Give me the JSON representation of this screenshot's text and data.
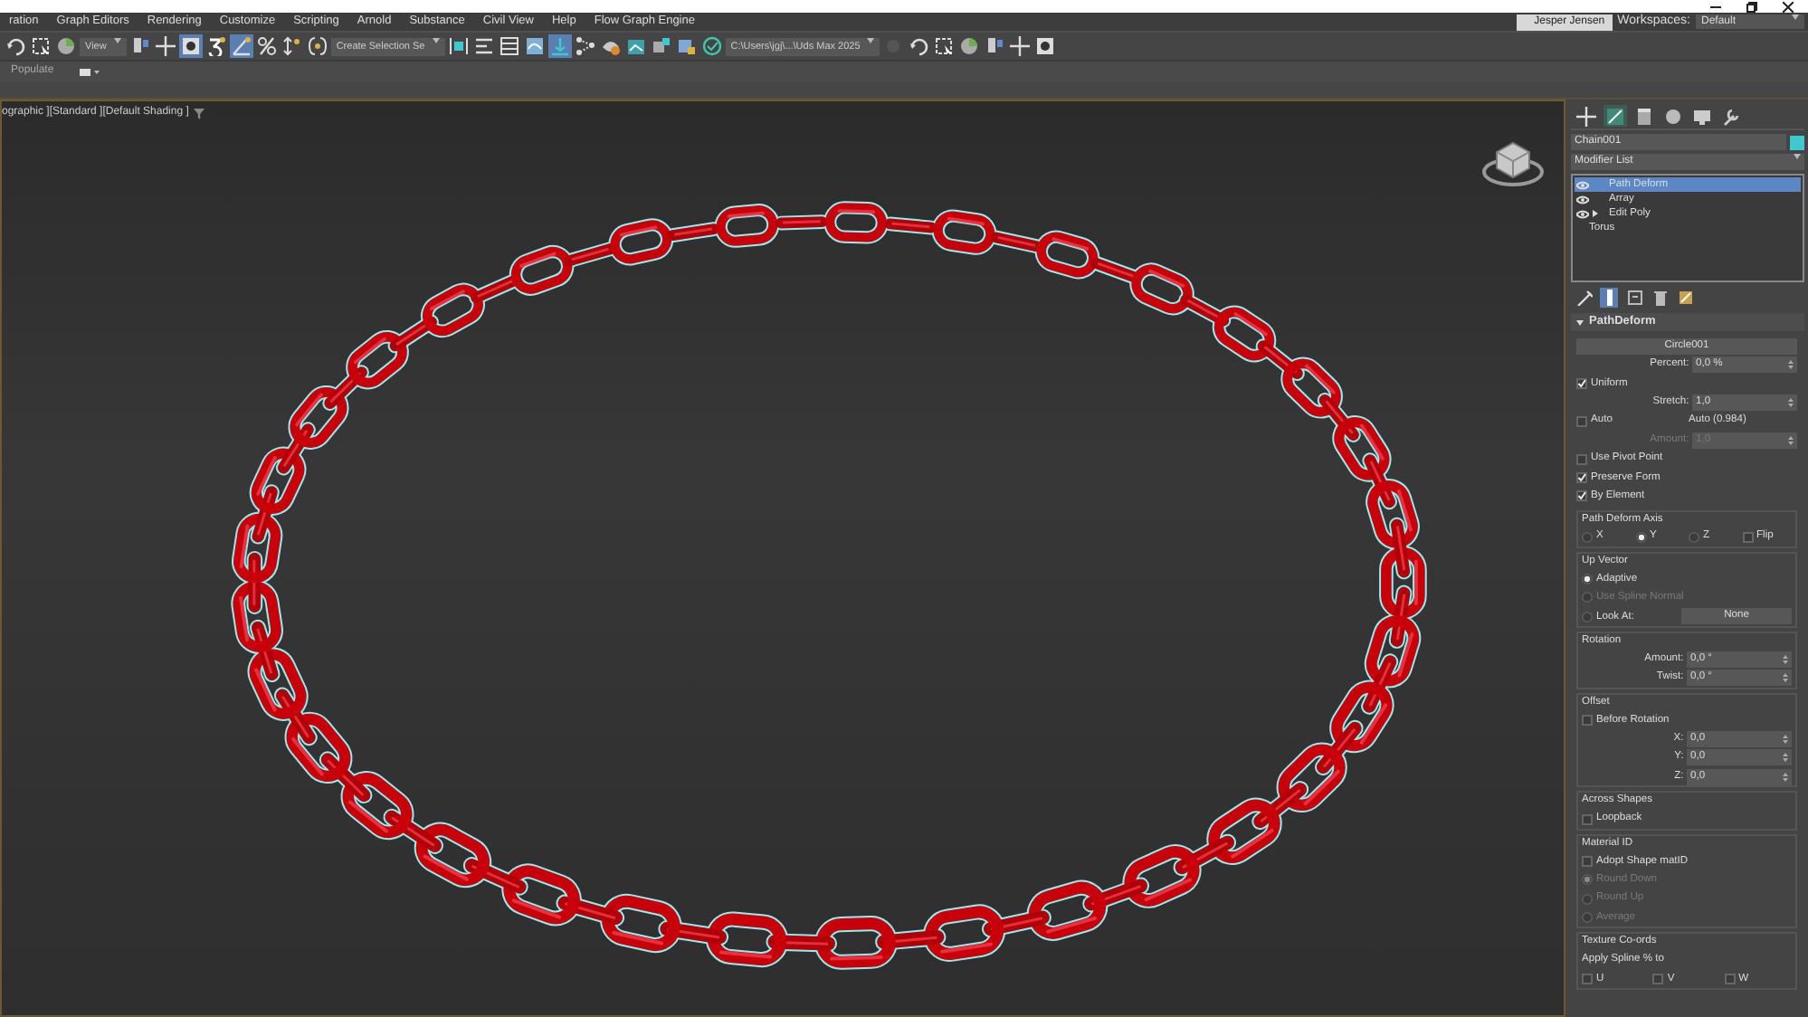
{
  "menu_bar": {
    "items": [
      "ration",
      "Graph Editors",
      "Rendering",
      "Customize",
      "Scripting",
      "Arnold",
      "Substance",
      "Civil View",
      "Help",
      "Flow Graph Engine"
    ]
  },
  "account": {
    "user": "Jesper Jensen",
    "workspaces_label": "Workspaces:",
    "workspace": "Default"
  },
  "toolbar": {
    "items": [
      {
        "kind": "tool",
        "pressed": false
      },
      {
        "kind": "tool",
        "pressed": false
      },
      {
        "kind": "tool",
        "pressed": false
      },
      {
        "kind": "dropdown",
        "value": "View"
      },
      {
        "kind": "tool",
        "pressed": false
      },
      {
        "kind": "tool",
        "pressed": false
      },
      {
        "kind": "tool",
        "pressed": true
      },
      {
        "kind": "tool",
        "pressed": false
      },
      {
        "kind": "tool",
        "pressed": true
      },
      {
        "kind": "tool",
        "pressed": false
      },
      {
        "kind": "tool",
        "pressed": false
      },
      {
        "kind": "tool",
        "pressed": false
      },
      {
        "kind": "dropdown",
        "value": "Create Selection Se"
      },
      {
        "kind": "tool",
        "pressed": false
      },
      {
        "kind": "tool",
        "pressed": false
      },
      {
        "kind": "tool",
        "pressed": false
      },
      {
        "kind": "tool",
        "pressed": false
      },
      {
        "kind": "tool",
        "pressed": true
      },
      {
        "kind": "tool",
        "pressed": false
      },
      {
        "kind": "tool",
        "pressed": false
      },
      {
        "kind": "tool",
        "pressed": false
      },
      {
        "kind": "tool",
        "pressed": false
      },
      {
        "kind": "tool",
        "pressed": false
      },
      {
        "kind": "tool",
        "pressed": false
      },
      {
        "kind": "dropdown",
        "value": "C:\\Users\\jgj\\...\\Uds Max 2025"
      },
      {
        "kind": "tool",
        "pressed": false
      },
      {
        "kind": "tool",
        "pressed": false
      },
      {
        "kind": "tool",
        "pressed": false
      },
      {
        "kind": "tool",
        "pressed": false
      },
      {
        "kind": "tool",
        "pressed": false
      },
      {
        "kind": "tool",
        "pressed": false
      },
      {
        "kind": "tool",
        "pressed": false
      }
    ]
  },
  "ribbon": {
    "tabs": [
      {
        "label": "Populate"
      }
    ]
  },
  "viewport": {
    "label": "ographic ][Standard ][Default Shading ]"
  },
  "command_panel": {
    "tabs": [
      {
        "selected": false
      },
      {
        "selected": true
      },
      {
        "selected": false
      },
      {
        "selected": false
      },
      {
        "selected": false
      },
      {
        "selected": false
      }
    ],
    "object": {
      "name": "Chain001",
      "color": "#3ec8d2"
    },
    "modifier_list": "Modifier List",
    "stack": [
      {
        "kind": "modifier",
        "label": "Path Deform",
        "visible": true,
        "expandable": false,
        "selected": true
      },
      {
        "kind": "modifier",
        "label": "Array",
        "visible": true,
        "expandable": false,
        "selected": false
      },
      {
        "kind": "modifier",
        "label": "Edit Poly",
        "visible": true,
        "expandable": true,
        "selected": false
      },
      {
        "kind": "base",
        "label": "Torus",
        "selected": false
      }
    ],
    "stack_tools": [
      {
        "pressed": false
      },
      {
        "pressed": true
      },
      {
        "pressed": false
      },
      {
        "pressed": false
      },
      {
        "pressed": false
      }
    ],
    "rollout": {
      "title": "PathDeform",
      "sections": [
        {
          "rows": [
            [
              {
                "kind": "button",
                "label": "Circle001"
              }
            ],
            [
              {
                "kind": "spinner",
                "label": "Percent:",
                "value": "0,0 %",
                "disabled": false
              }
            ],
            [
              {
                "kind": "checkbox",
                "label": "Uniform",
                "checked": true,
                "disabled": false
              }
            ],
            [
              {
                "kind": "spinner",
                "label": "Stretch:",
                "value": "1,0",
                "disabled": false
              }
            ],
            [
              {
                "kind": "checkbox",
                "label": "Auto",
                "checked": false,
                "disabled": false
              },
              {
                "kind": "text",
                "label": "Auto (0.984)",
                "disabled": false
              }
            ],
            [
              {
                "kind": "spinner",
                "label": "Amount:",
                "value": "1,0",
                "disabled": true
              }
            ],
            [
              {
                "kind": "checkbox",
                "label": "Use Pivot Point",
                "checked": false,
                "disabled": false
              }
            ],
            [
              {
                "kind": "checkbox",
                "label": "Preserve Form",
                "checked": true,
                "disabled": false
              }
            ],
            [
              {
                "kind": "checkbox",
                "label": "By Element",
                "checked": true,
                "disabled": false
              }
            ]
          ]
        },
        {
          "title": "Path Deform Axis",
          "rows": [
            [
              {
                "kind": "radio",
                "label": "X",
                "selected": false,
                "disabled": false
              },
              {
                "kind": "radio",
                "label": "Y",
                "selected": true,
                "disabled": false
              },
              {
                "kind": "radio",
                "label": "Z",
                "selected": false,
                "disabled": false
              },
              {
                "kind": "checkbox",
                "label": "Flip",
                "checked": false,
                "disabled": false
              }
            ]
          ]
        },
        {
          "title": "Up Vector",
          "rows": [
            [
              {
                "kind": "radio",
                "label": "Adaptive",
                "selected": true,
                "disabled": false
              }
            ],
            [
              {
                "kind": "radio",
                "label": "Use Spline Normal",
                "selected": false,
                "disabled": true
              }
            ],
            [
              {
                "kind": "radio",
                "label": "Look At:",
                "selected": false,
                "disabled": false
              },
              {
                "kind": "button",
                "label": "None"
              }
            ]
          ]
        },
        {
          "title": "Rotation",
          "rows": [
            [
              {
                "kind": "spinner",
                "label": "Amount:",
                "value": "0,0 °",
                "disabled": false
              }
            ],
            [
              {
                "kind": "spinner",
                "label": "Twist:",
                "value": "0,0 °",
                "disabled": false
              }
            ]
          ]
        },
        {
          "title": "Offset",
          "rows": [
            [
              {
                "kind": "checkbox",
                "label": "Before Rotation",
                "checked": false,
                "disabled": false
              }
            ],
            [
              {
                "kind": "spinner",
                "label": "X:",
                "value": "0,0",
                "disabled": false
              }
            ],
            [
              {
                "kind": "spinner",
                "label": "Y:",
                "value": "0,0",
                "disabled": false
              }
            ],
            [
              {
                "kind": "spinner",
                "label": "Z:",
                "value": "0,0",
                "disabled": false
              }
            ]
          ]
        },
        {
          "title": "Across Shapes",
          "rows": [
            [
              {
                "kind": "checkbox",
                "label": "Loopback",
                "checked": false,
                "disabled": false
              }
            ]
          ]
        },
        {
          "title": "Material ID",
          "rows": [
            [
              {
                "kind": "checkbox",
                "label": "Adopt Shape matID",
                "checked": false,
                "disabled": false
              }
            ],
            [
              {
                "kind": "radio",
                "label": "Round Down",
                "selected": true,
                "disabled": true
              }
            ],
            [
              {
                "kind": "radio",
                "label": "Round Up",
                "selected": false,
                "disabled": true
              }
            ],
            [
              {
                "kind": "radio",
                "label": "Average",
                "selected": false,
                "disabled": true
              }
            ]
          ]
        },
        {
          "title": "Texture Co-ords",
          "rows": [
            [
              {
                "kind": "text",
                "label": "Apply Spline % to",
                "disabled": false
              }
            ],
            [
              {
                "kind": "checkbox",
                "label": "U",
                "checked": false,
                "disabled": false
              },
              {
                "kind": "checkbox",
                "label": "V",
                "checked": false,
                "disabled": false
              },
              {
                "kind": "checkbox",
                "label": "W",
                "checked": false,
                "disabled": false
              }
            ]
          ]
        }
      ]
    }
  }
}
